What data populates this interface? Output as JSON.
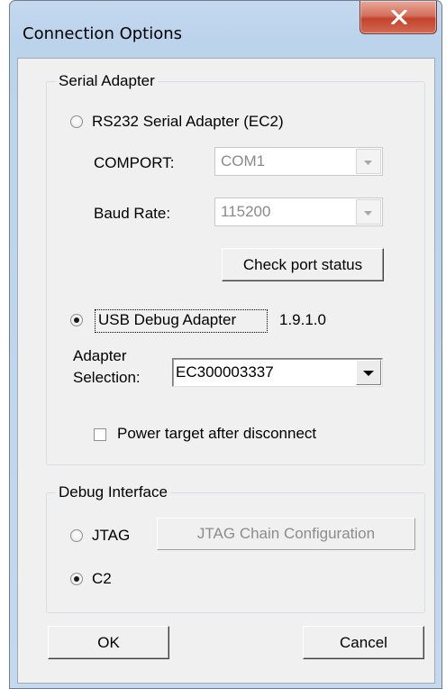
{
  "window": {
    "title": "Connection Options",
    "close_icon": "close-x-icon",
    "colors": {
      "frame": "#bcd3ec",
      "close_button": "#c4432d",
      "client": "#f0f0f0"
    }
  },
  "serial_adapter": {
    "group_label": "Serial Adapter",
    "rs232_label": "RS232 Serial Adapter (EC2)",
    "rs232_checked": false,
    "comport_label": "COMPORT:",
    "comport_value": "COM1",
    "baud_label": "Baud Rate:",
    "baud_value": "115200",
    "check_port_label": "Check port status",
    "usb_label": "USB Debug Adapter",
    "usb_checked": true,
    "usb_version": "1.9.1.0",
    "adapter_label_line1": "Adapter",
    "adapter_label_line2": "Selection:",
    "adapter_value": "EC300003337",
    "power_label": "Power target after disconnect",
    "power_checked": false
  },
  "debug_interface": {
    "group_label": "Debug Interface",
    "jtag_label": "JTAG",
    "jtag_checked": false,
    "jtag_chain_label": "JTAG Chain Configuration",
    "c2_label": "C2",
    "c2_checked": true
  },
  "buttons": {
    "ok_label": "OK",
    "cancel_label": "Cancel"
  }
}
